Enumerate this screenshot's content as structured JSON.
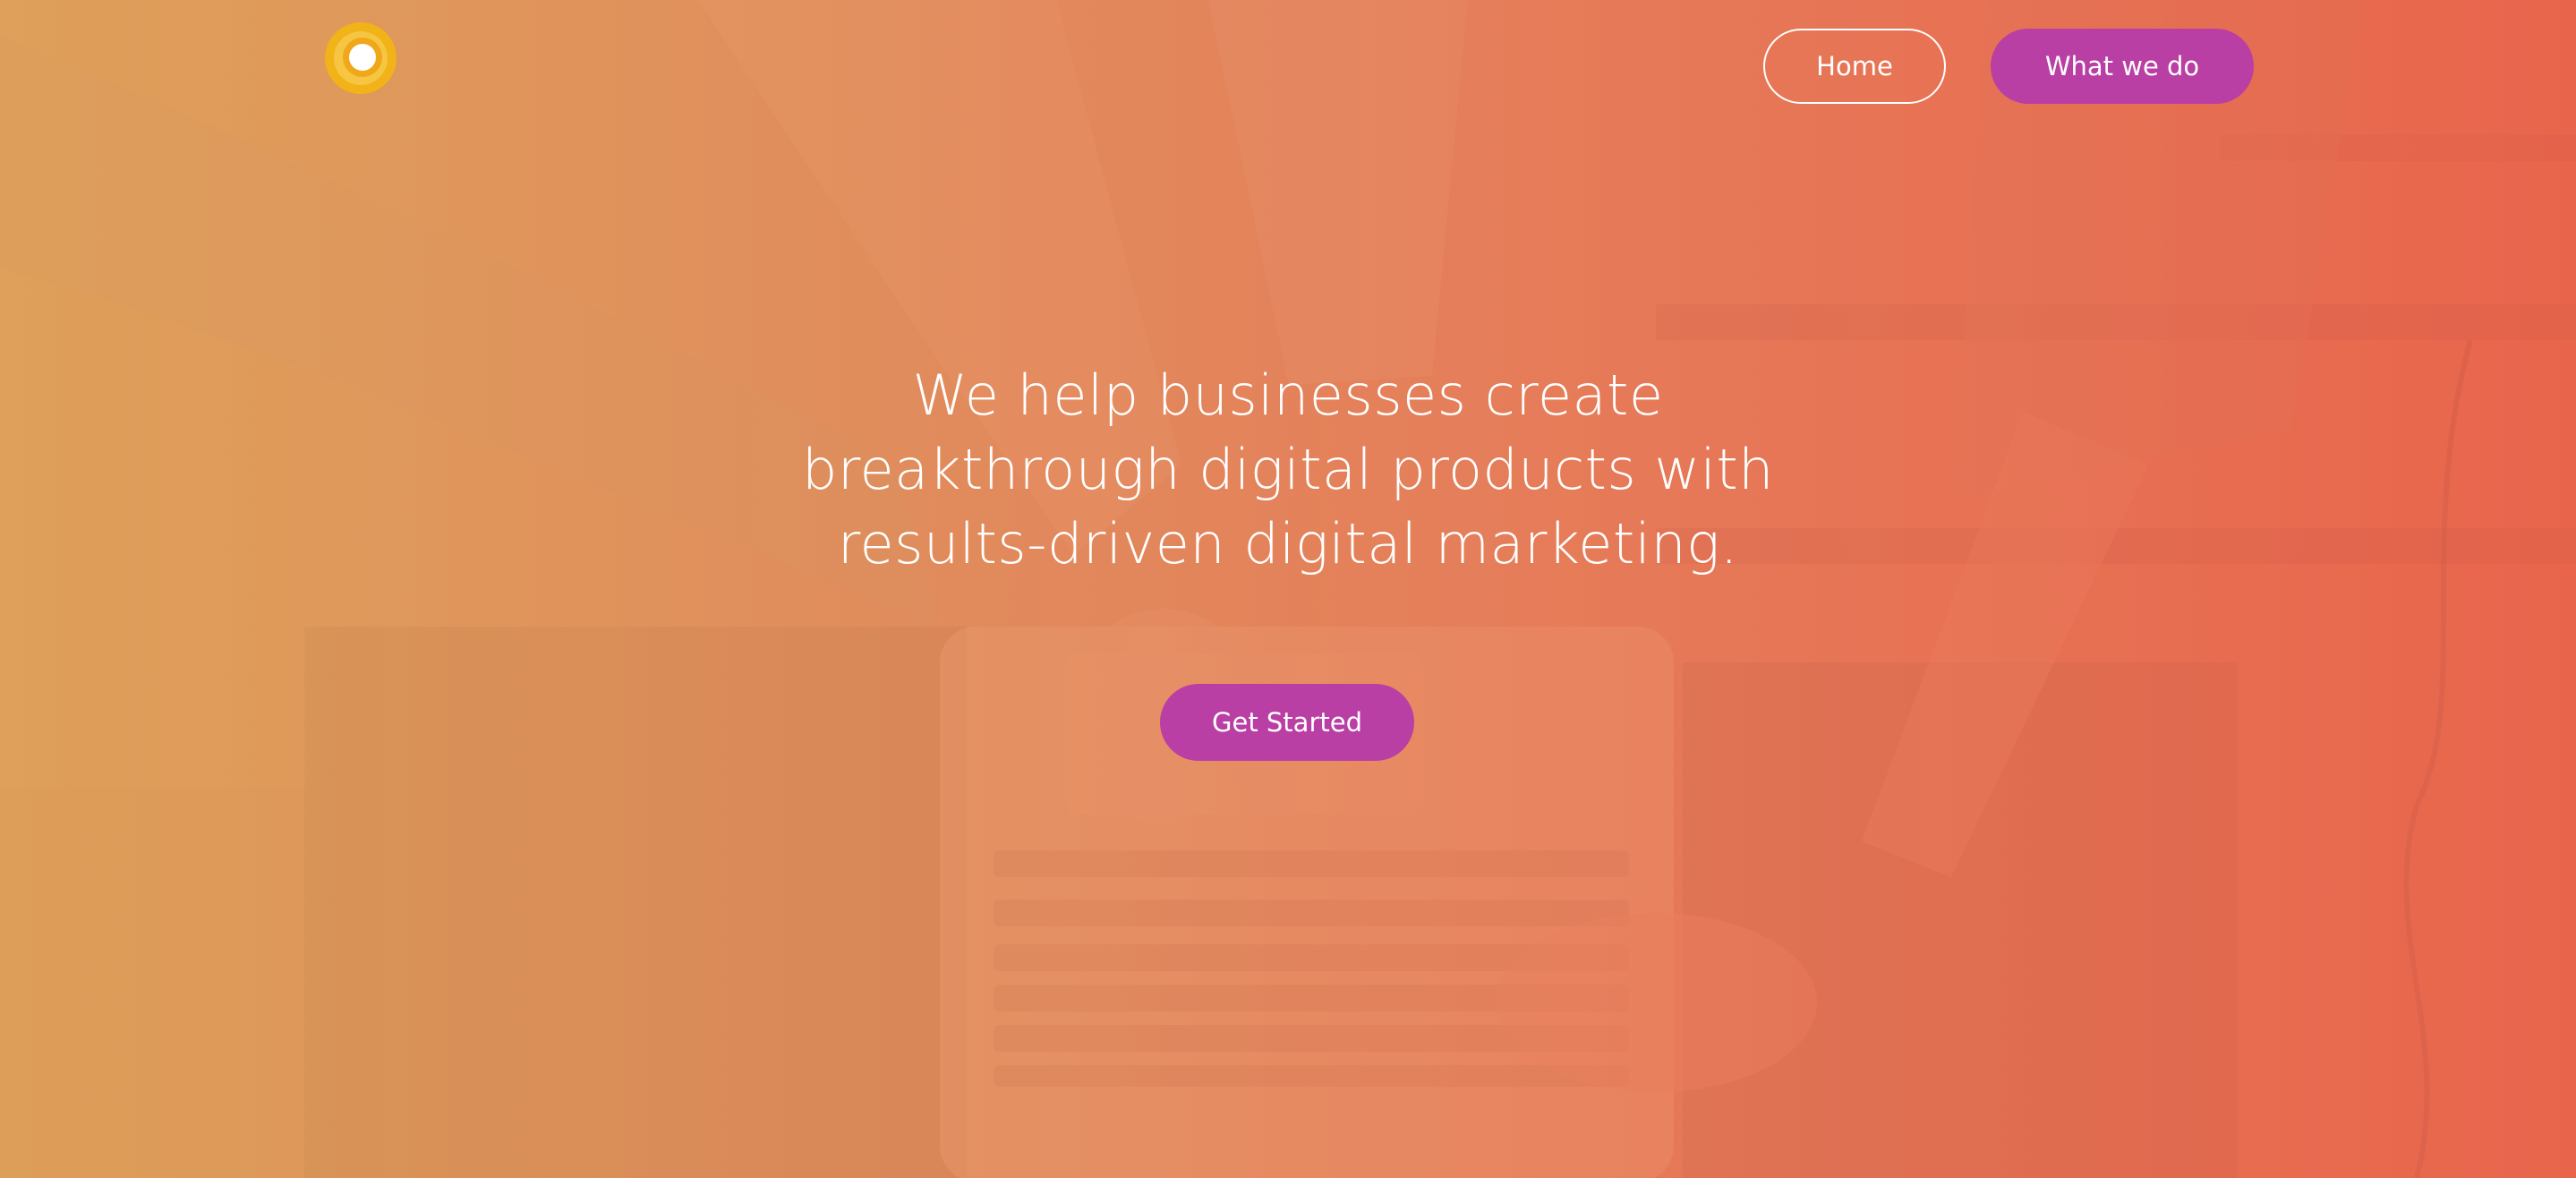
{
  "brand": {
    "logo_icon": "sun-ring-logo-icon",
    "colors": {
      "accent": "#b93fa4",
      "logo_outer": "#f2b318",
      "logo_inner": "#ffffff",
      "overlay_left": "#dca05a",
      "overlay_right": "#e8664d"
    }
  },
  "nav": {
    "home_label": "Home",
    "what_we_do_label": "What we do"
  },
  "hero": {
    "headline_line1": "We help businesses create",
    "headline_line2": "breakthrough digital products with",
    "headline_line3": "results-driven digital marketing.",
    "cta_label": "Get Started"
  }
}
